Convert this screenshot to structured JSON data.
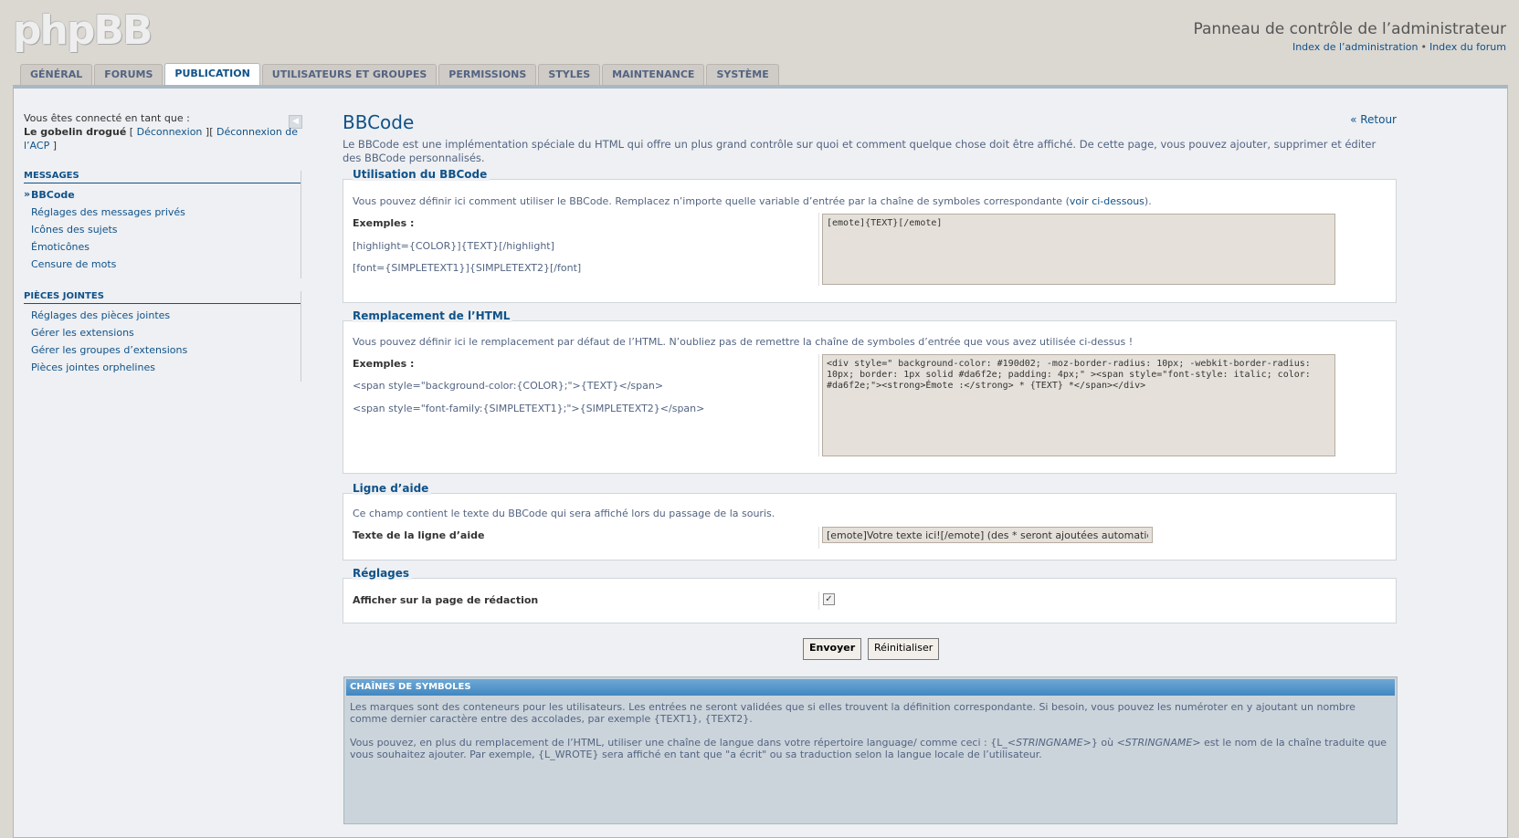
{
  "header": {
    "logo": "phpBB",
    "panel_title": "Panneau de contrôle de l’administrateur",
    "links": [
      "Index de l’administration",
      "Index du forum"
    ]
  },
  "tabs": [
    {
      "label": "GÉNÉRAL",
      "active": false
    },
    {
      "label": "FORUMS",
      "active": false
    },
    {
      "label": "PUBLICATION",
      "active": true
    },
    {
      "label": "UTILISATEURS ET GROUPES",
      "active": false
    },
    {
      "label": "PERMISSIONS",
      "active": false
    },
    {
      "label": "STYLES",
      "active": false
    },
    {
      "label": "MAINTENANCE",
      "active": false
    },
    {
      "label": "SYSTÈME",
      "active": false
    }
  ],
  "sidebar": {
    "connected_label": "Vous êtes connecté en tant que :",
    "username": "Le gobelin drogué",
    "logout": "Déconnexion",
    "logout_acp": "Déconnexion de l’ACP",
    "groups": [
      {
        "title": "MESSAGES",
        "items": [
          {
            "label": "BBCode",
            "active": true
          },
          {
            "label": "Réglages des messages privés",
            "active": false
          },
          {
            "label": "Icônes des sujets",
            "active": false
          },
          {
            "label": "Émoticônes",
            "active": false
          },
          {
            "label": "Censure de mots",
            "active": false
          }
        ]
      },
      {
        "title": "PIÈCES JOINTES",
        "items": [
          {
            "label": "Réglages des pièces jointes",
            "active": false
          },
          {
            "label": "Gérer les extensions",
            "active": false
          },
          {
            "label": "Gérer les groupes d’extensions",
            "active": false
          },
          {
            "label": "Pièces jointes orphelines",
            "active": false
          }
        ]
      }
    ]
  },
  "content": {
    "title": "BBCode",
    "back_link": "« Retour",
    "intro": "Le BBCode est une implémentation spéciale du HTML qui offre un plus grand contrôle sur quoi et comment quelque chose doit être affiché. De cette page, vous pouvez ajouter, supprimer et éditer des BBCode personnalisés.",
    "usage": {
      "legend": "Utilisation du BBCode",
      "desc_before": "Vous pouvez définir ici comment utiliser le BBCode. Remplacez n’importe quelle variable d’entrée par la chaîne de symboles correspondante (",
      "desc_link": "voir ci-dessous",
      "desc_after": ").",
      "examples_label": "Exemples :",
      "examples": [
        "[highlight={COLOR}]{TEXT}[/highlight]",
        "[font={SIMPLETEXT1}]{SIMPLETEXT2}[/font]"
      ],
      "value": "[emote]{TEXT}[/emote]"
    },
    "html": {
      "legend": "Remplacement de l’HTML",
      "desc": "Vous pouvez définir ici le remplacement par défaut de l’HTML. N’oubliez pas de remettre la chaîne de symboles d’entrée que vous avez utilisée ci-dessus !",
      "examples_label": "Exemples :",
      "examples": [
        "<span style=\"background-color:{COLOR};\">{TEXT}</span>",
        "<span style=\"font-family:{SIMPLETEXT1};\">{SIMPLETEXT2}</span>"
      ],
      "value": "<div style=\" background-color: #190d02; -moz-border-radius: 10px; -webkit-border-radius: 10px; border: 1px solid #da6f2e; padding: 4px;\" ><span style=\"font-style: italic; color: #da6f2e;\"><strong>Émote :</strong> * {TEXT} *</span></div>"
    },
    "helpline": {
      "legend": "Ligne d’aide",
      "desc": "Ce champ contient le texte du BBCode qui sera affiché lors du passage de la souris.",
      "label": "Texte de la ligne d’aide",
      "value": "[emote]Votre texte ici![/emote] (des * seront ajoutées automatiquement)"
    },
    "settings": {
      "legend": "Réglages",
      "label": "Afficher sur la page de rédaction",
      "checked": true
    },
    "buttons": {
      "submit": "Envoyer",
      "reset": "Réinitialiser"
    },
    "tokens": {
      "header": "CHAÎNES DE SYMBOLES",
      "p1": "Les marques sont des conteneurs pour les utilisateurs. Les entrées ne seront validées que si elles trouvent la définition correspondante. Si besoin, vous pouvez les numéroter en y ajoutant un nombre comme dernier caractère entre des accolades, par exemple {TEXT1}, {TEXT2}.",
      "p2_a": "Vous pouvez, en plus du remplacement de l’HTML, utiliser une chaîne de langue dans votre répertoire language/ comme ceci : {L_",
      "p2_em1": "<STRINGNAME>",
      "p2_b": "} où ",
      "p2_em2": "<STRINGNAME>",
      "p2_c": " est le nom de la chaîne traduite que vous souhaitez ajouter. Par exemple, {L_WROTE} sera affiché en tant que \"a écrit\" ou sa traduction selon la langue locale de l’utilisateur."
    }
  },
  "colors": {
    "link": "#105289",
    "page_bg": "#dbd7d1",
    "panel_bg": "#eef0f3",
    "tokens_header": "#4087c0"
  }
}
